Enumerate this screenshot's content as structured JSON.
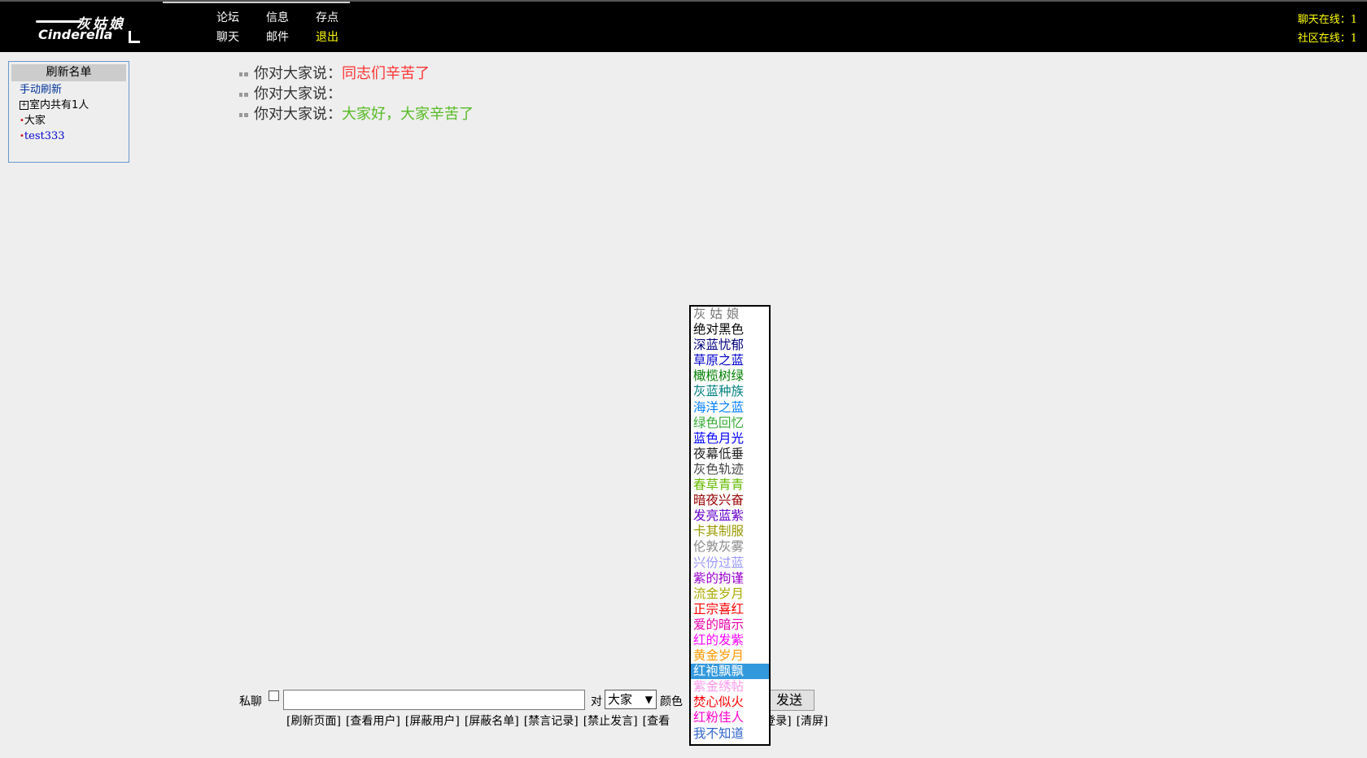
{
  "header": {
    "logo": {
      "cn": "灰姑娘",
      "en": "Cinderella"
    },
    "nav": [
      {
        "label": "论坛"
      },
      {
        "label": "信息"
      },
      {
        "label": "存点"
      },
      {
        "label": "聊天"
      },
      {
        "label": "邮件"
      },
      {
        "label": "退出"
      }
    ],
    "online": {
      "chat": "聊天在线：1",
      "community": "社区在线：1"
    }
  },
  "user_panel": {
    "title": "刷新名单",
    "refresh_link": "手动刷新",
    "room_count": "室内共有1人",
    "expand_glyph": "+",
    "dot": "•",
    "users": [
      "大家",
      "test333"
    ]
  },
  "messages": [
    {
      "prefix": "你对大家说：",
      "text": "同志们辛苦了",
      "color": "#ff3333"
    },
    {
      "prefix": "你对大家说：",
      "text": "",
      "color": "#000000"
    },
    {
      "prefix": "你对大家说：",
      "text": "大家好，大家辛苦了",
      "color": "#55bb22"
    }
  ],
  "input_bar": {
    "private_label": "私聊",
    "message_value": "",
    "to_label": "对",
    "target_value": "大家",
    "color_label": "颜色",
    "send_label": "发送"
  },
  "commands": [
    "[刷新页面]",
    "[查看用户]",
    "[屏蔽用户]",
    "[屏蔽名单]",
    "[禁言记录]",
    "[禁止发言]",
    "[查看",
    "禁止登录]",
    "[清屏]"
  ],
  "color_options": [
    {
      "label": "灰 姑 娘",
      "color": "#777777"
    },
    {
      "label": "绝对黑色",
      "color": "#000000"
    },
    {
      "label": "深蓝忧郁",
      "color": "#000080"
    },
    {
      "label": "草原之蓝",
      "color": "#0000cc"
    },
    {
      "label": "橄榄树绿",
      "color": "#008000"
    },
    {
      "label": "灰蓝种族",
      "color": "#008080"
    },
    {
      "label": "海洋之蓝",
      "color": "#0080ff"
    },
    {
      "label": "绿色回忆",
      "color": "#33aa33"
    },
    {
      "label": "蓝色月光",
      "color": "#0000ff"
    },
    {
      "label": "夜幕低垂",
      "color": "#222222"
    },
    {
      "label": "灰色轨迹",
      "color": "#444444"
    },
    {
      "label": "春草青青",
      "color": "#66bb00"
    },
    {
      "label": "暗夜兴奋",
      "color": "#990000"
    },
    {
      "label": "发亮蓝紫",
      "color": "#6600cc"
    },
    {
      "label": "卡其制服",
      "color": "#999900"
    },
    {
      "label": "伦敦灰雾",
      "color": "#888888"
    },
    {
      "label": "兴份过蓝",
      "color": "#9999ff"
    },
    {
      "label": "紫的拘谨",
      "color": "#9900cc"
    },
    {
      "label": "流金岁月",
      "color": "#aaaa00"
    },
    {
      "label": "正宗喜红",
      "color": "#ff0000"
    },
    {
      "label": "爱的暗示",
      "color": "#ee00aa"
    },
    {
      "label": "红的发紫",
      "color": "#ff00ff"
    },
    {
      "label": "黄金岁月",
      "color": "#ff9900"
    },
    {
      "label": "红袍飘飘",
      "color": "#ffffff",
      "selected": true
    },
    {
      "label": "紫金绣帖",
      "color": "#ff99ee"
    },
    {
      "label": "焚心似火",
      "color": "#ff0000"
    },
    {
      "label": "红粉佳人",
      "color": "#ff00cc"
    },
    {
      "label": "我不知道",
      "color": "#3366cc"
    }
  ]
}
